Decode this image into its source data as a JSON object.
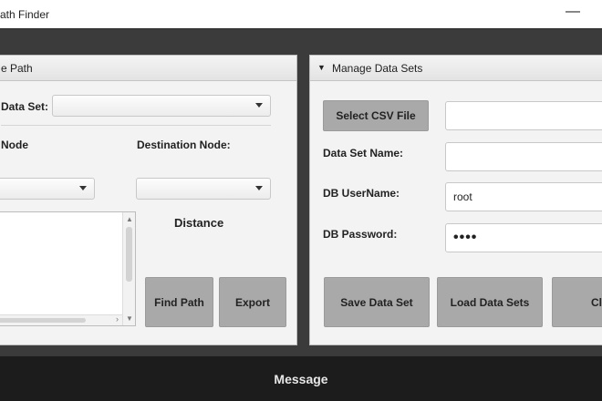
{
  "window": {
    "title": "ath Finder",
    "minimize_glyph": "—"
  },
  "left_panel": {
    "header": "e Path",
    "dataset_label": "Data Set:",
    "source_label": "Node",
    "destination_label": "Destination Node:",
    "distance_label": "Distance",
    "find_path_button": "Find Path",
    "export_button": "Export"
  },
  "right_panel": {
    "header_arrow": "▼",
    "header": "Manage Data Sets",
    "select_csv_button": "Select CSV File",
    "csv_path_value": "",
    "dataset_name_label": "Data Set Name:",
    "dataset_name_value": "",
    "db_username_label": "DB UserName:",
    "db_username_value": "root",
    "db_password_label": "DB Password:",
    "db_password_value": "••••",
    "save_button": "Save Data Set",
    "load_button": "Load Data Sets",
    "third_button": "Cl"
  },
  "status": {
    "message": "Message"
  }
}
